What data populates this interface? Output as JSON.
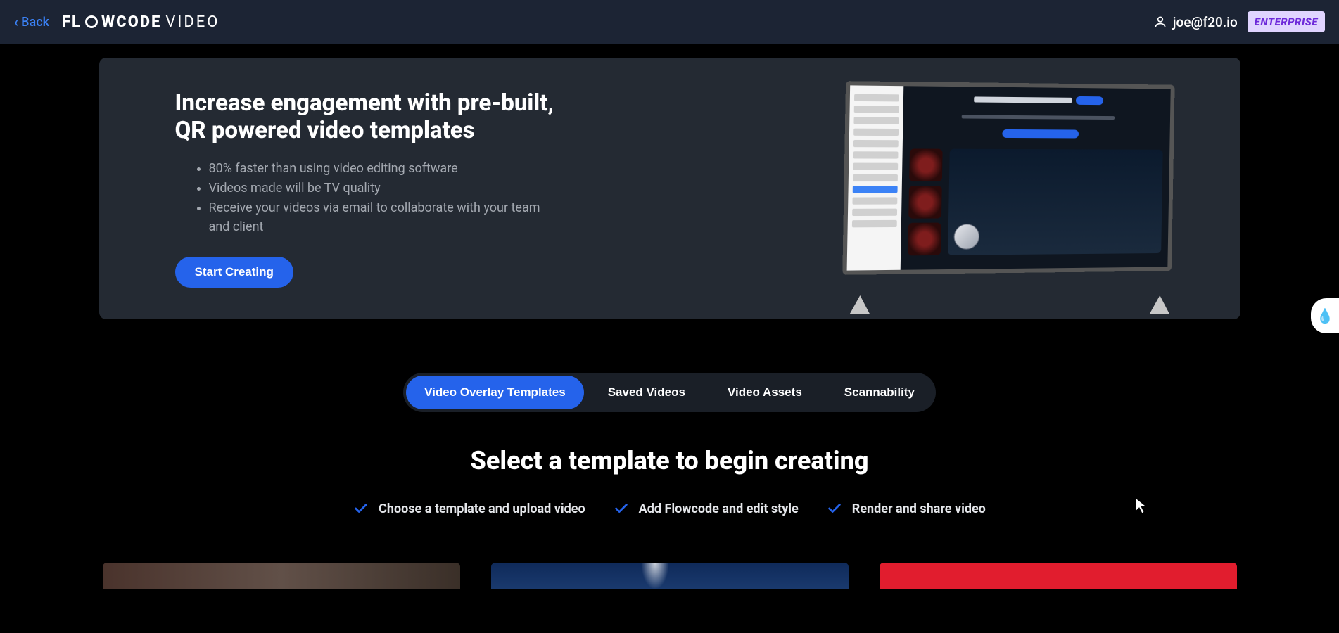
{
  "header": {
    "back_label": "Back",
    "logo_prefix": "FL",
    "logo_suffix": "WCODE",
    "logo_video": "VIDEO",
    "user_email": "joe@f20.io",
    "badge": "ENTERPRISE"
  },
  "hero": {
    "heading_line1": "Increase engagement with pre-built,",
    "heading_line2": "QR powered video templates",
    "bullets": [
      "80% faster than using video editing software",
      "Videos made will be TV quality",
      "Receive your videos via email to collaborate with your team and client"
    ],
    "cta": "Start Creating"
  },
  "tabs": [
    {
      "label": "Video Overlay Templates",
      "active": true
    },
    {
      "label": "Saved Videos",
      "active": false
    },
    {
      "label": "Video Assets",
      "active": false
    },
    {
      "label": "Scannability",
      "active": false
    }
  ],
  "section_title": "Select a template to begin creating",
  "steps": [
    "Choose a template and upload video",
    "Add Flowcode and edit style",
    "Render and share video"
  ],
  "colors": {
    "accent": "#2563eb",
    "header_bg": "#1c2434",
    "card_bg": "#242a33",
    "badge_bg": "#e0d4ff",
    "badge_text": "#6d28d9"
  }
}
